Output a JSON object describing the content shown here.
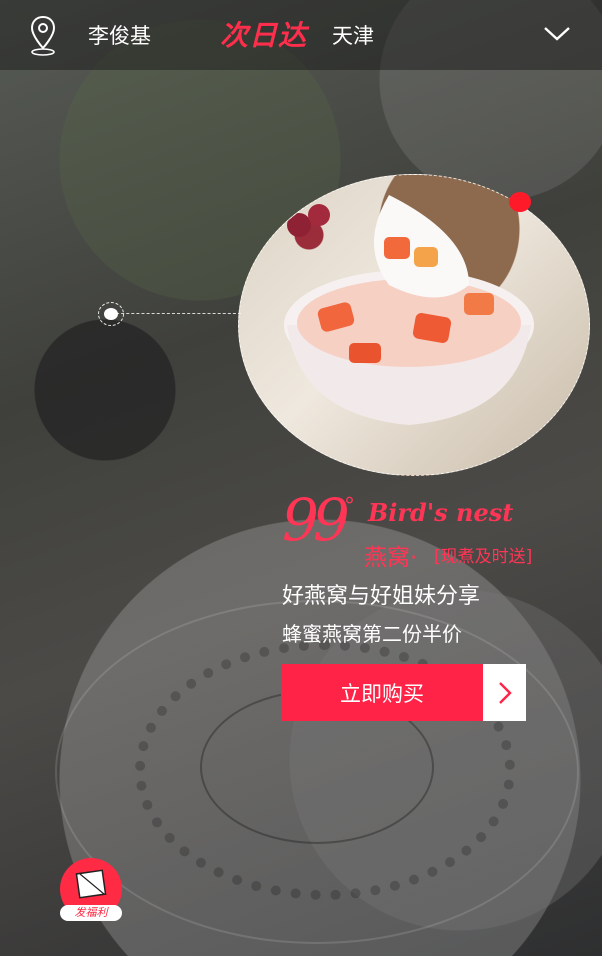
{
  "header": {
    "user_name": "李俊基",
    "brand": "次日达",
    "city": "天津"
  },
  "promo": {
    "logo_number": "99",
    "logo_degree": "°",
    "logo_english": "Bird's nest",
    "logo_chinese": "燕窝·",
    "logo_tagline": "[现煮及时送]",
    "headline": "好燕窝与好姐妹分享",
    "subline": "蜂蜜燕窝第二份半价",
    "buy_label": "立即购买"
  },
  "badge": {
    "label": "发福利"
  },
  "colors": {
    "accent": "#ff2447",
    "header_bg": "rgba(20,20,20,0.45)"
  },
  "icons": {
    "location": "location-pin-icon",
    "dropdown": "chevron-down-icon",
    "arrow": "chevron-right-icon",
    "gift": "gift-box-icon"
  }
}
